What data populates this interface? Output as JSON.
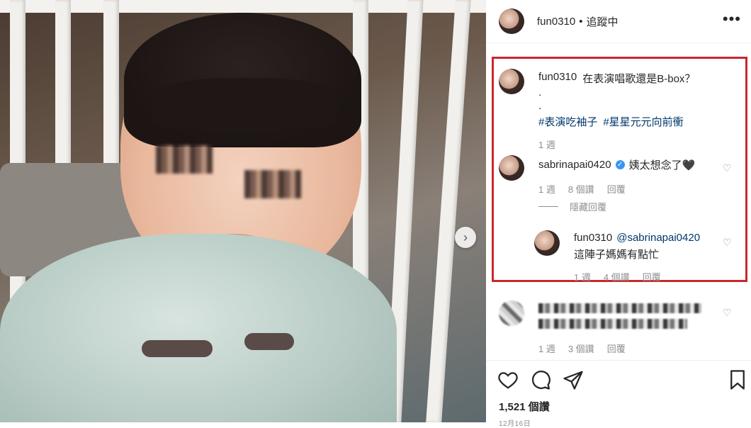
{
  "post": {
    "username": "fun0310",
    "separator": "•",
    "follow_status": "追蹤中",
    "more_label": "•••"
  },
  "caption": {
    "username": "fun0310",
    "text": "在表演唱歌還是B-box？",
    "dot1": ".",
    "dot2": ".",
    "tag1": "#表演吃袖子",
    "tag2": "#星星元元向前衝",
    "time": "1 週"
  },
  "comments": [
    {
      "username": "sabrinapai0420",
      "text": "姨太想念了🖤",
      "time": "1 週",
      "likes": "8 個讚",
      "reply_label": "回覆",
      "hide_replies": "隱藏回覆",
      "reply": {
        "username": "fun0310",
        "mention": "@sabrinapai0420",
        "text": "這陣子媽媽有點忙",
        "time": "1 週",
        "likes": "4 個讚",
        "reply_label": "回覆"
      }
    },
    {
      "time": "1 週",
      "likes": "3 個讚",
      "reply_label": "回覆"
    }
  ],
  "footer": {
    "likes": "1,521 個讚",
    "date": "12月16日"
  },
  "icons": [
    "heart-icon",
    "comment-icon",
    "share-icon",
    "bookmark-icon",
    "more-icon",
    "chevron-right-icon",
    "verified-icon"
  ],
  "colors": {
    "highlight_border": "#c8282e",
    "hashtag": "#00376b",
    "verified": "#3897f0",
    "meta_text": "#8e8e8e"
  }
}
